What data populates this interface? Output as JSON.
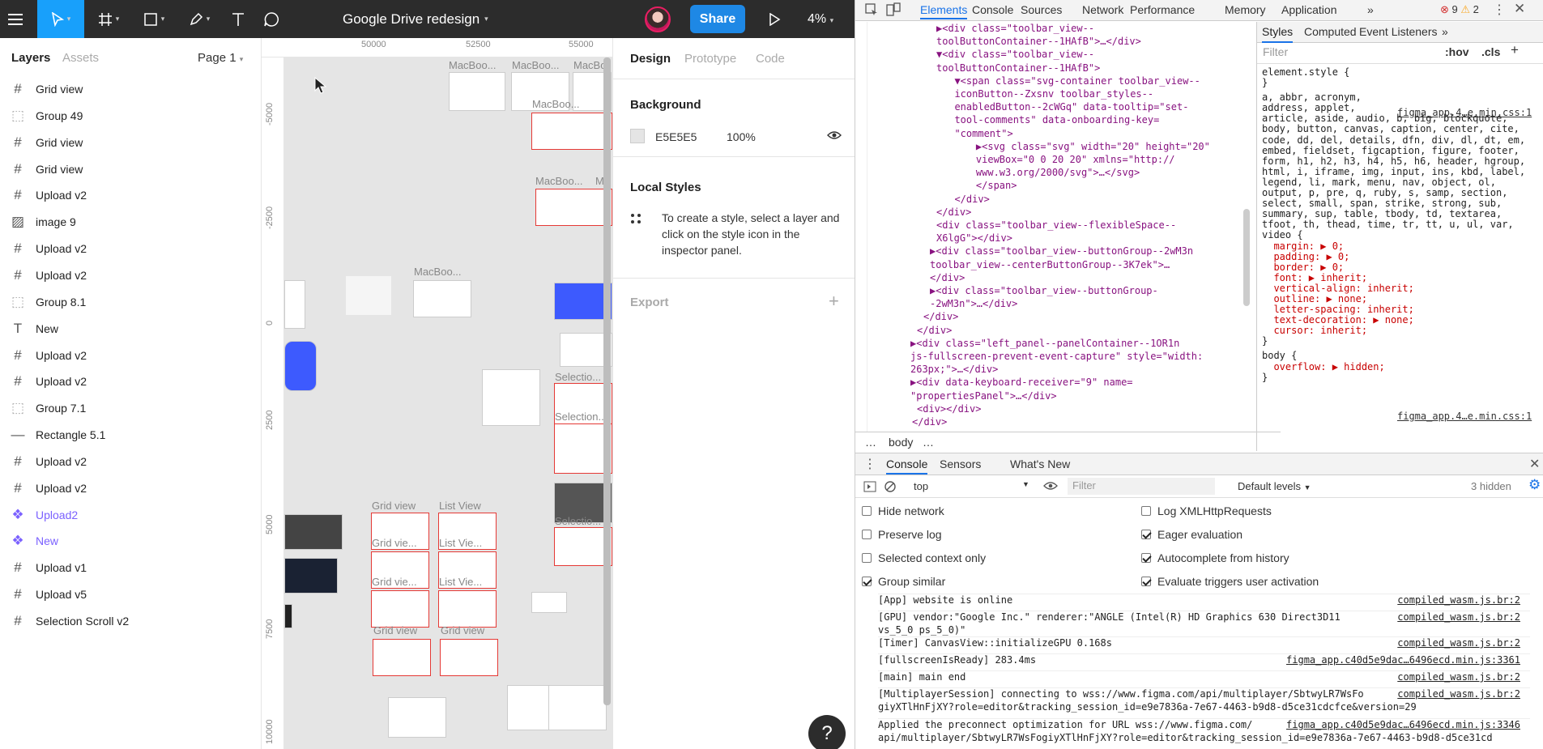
{
  "figma": {
    "file_title": "Google Drive redesign",
    "share_label": "Share",
    "zoom": "4%",
    "left_tabs": {
      "layers": "Layers",
      "assets": "Assets",
      "page": "Page 1"
    },
    "layers": [
      {
        "name": "Grid view",
        "icon": "frame-icon",
        "kind": "frame"
      },
      {
        "name": "Group 49",
        "icon": "group-icon",
        "kind": "group"
      },
      {
        "name": "Grid view",
        "icon": "frame-icon",
        "kind": "frame"
      },
      {
        "name": "Grid view",
        "icon": "frame-icon",
        "kind": "frame"
      },
      {
        "name": "Upload v2",
        "icon": "frame-icon",
        "kind": "frame"
      },
      {
        "name": "image 9",
        "icon": "image-icon",
        "kind": "image"
      },
      {
        "name": "Upload v2",
        "icon": "frame-icon",
        "kind": "frame"
      },
      {
        "name": "Upload v2",
        "icon": "frame-icon",
        "kind": "frame"
      },
      {
        "name": "Group 8.1",
        "icon": "group-icon",
        "kind": "group"
      },
      {
        "name": "New",
        "icon": "text-icon",
        "kind": "text"
      },
      {
        "name": "Upload v2",
        "icon": "frame-icon",
        "kind": "frame"
      },
      {
        "name": "Upload v2",
        "icon": "frame-icon",
        "kind": "frame"
      },
      {
        "name": "Group 7.1",
        "icon": "group-icon",
        "kind": "group"
      },
      {
        "name": "Rectangle 5.1",
        "icon": "line-icon",
        "kind": "line"
      },
      {
        "name": "Upload v2",
        "icon": "frame-icon",
        "kind": "frame"
      },
      {
        "name": "Upload v2",
        "icon": "frame-icon",
        "kind": "frame"
      },
      {
        "name": "Upload2",
        "icon": "component-icon",
        "kind": "component"
      },
      {
        "name": "New",
        "icon": "component-icon",
        "kind": "component"
      },
      {
        "name": "Upload v1",
        "icon": "frame-icon",
        "kind": "frame"
      },
      {
        "name": "Upload v5",
        "icon": "frame-icon",
        "kind": "frame"
      },
      {
        "name": "Selection Scroll v2",
        "icon": "frame-icon",
        "kind": "frame"
      }
    ],
    "ruler_top": [
      "50000",
      "52500",
      "55000"
    ],
    "ruler_left": [
      "-5000",
      "-2500",
      "0",
      "2500",
      "5000",
      "7500",
      "10000"
    ],
    "canvas_labels": [
      "MacBoo...",
      "MacBoo...",
      "MacBo",
      "MacBoo...",
      "MacBoo...",
      "Ma",
      "MacBoo...",
      "Grid view",
      "List View",
      "Grid vie...",
      "List Vie...",
      "Grid vie...",
      "List Vie...",
      "Grid view",
      "Grid view",
      "Selectio...",
      "Selection...",
      "Selectio..."
    ],
    "right_tabs": {
      "design": "Design",
      "prototype": "Prototype",
      "code": "Code"
    },
    "background": {
      "title": "Background",
      "hex": "E5E5E5",
      "opacity": "100%",
      "color": "#E5E5E5"
    },
    "local_styles": {
      "title": "Local Styles",
      "hint": "To create a style, select a layer and click on the style icon in the inspector panel."
    },
    "export": {
      "title": "Export",
      "add": "+"
    },
    "help": "?"
  },
  "devtools": {
    "tabs": [
      "Elements",
      "Console",
      "Sources",
      "Network",
      "Performance",
      "Memory",
      "Application",
      "»"
    ],
    "errors": "9",
    "warnings": "2",
    "elements_lines": [
      "▶<div class=\"toolbar_view--",
      "toolButtonContainer--1HAfB\">…</div>",
      "▼<div class=\"toolbar_view--",
      "toolButtonContainer--1HAfB\">",
      "  ▼<span class=\"svg-container toolbar_view--",
      "  iconButton--Zxsnv toolbar_styles--",
      "  enabledButton--2cWGq\" data-tooltip=\"set-",
      "  tool-comments\" data-onboarding-key=",
      "  \"comment\">",
      "    ▶<svg class=\"svg\" width=\"20\" height=\"20\"",
      "    viewBox=\"0 0 20 20\" xmlns=\"http://",
      "    www.w3.org/2000/svg\">…</svg>",
      "    </span>",
      "  </div>",
      "</div>",
      "<div class=\"toolbar_view--flexibleSpace--",
      "X6lgG\"></div>",
      "▶<div class=\"toolbar_view--buttonGroup--2wM3n",
      "toolbar_view--centerButtonGroup--3K7ek\">…",
      "</div>",
      "▶<div class=\"toolbar_view--buttonGroup-",
      "-2wM3n\">…</div>",
      "</div>",
      "</div>",
      "▶<div class=\"left_panel--panelContainer--1OR1n",
      "js-fullscreen-prevent-event-capture\" style=\"width:",
      "263px;\">…</div>",
      "▶<div data-keyboard-receiver=\"9\" name=",
      "\"propertiesPanel\">…</div>",
      "<div></div>",
      "</div>"
    ],
    "breadcrumb": [
      "…",
      "body",
      "…"
    ],
    "styles_tabs": [
      "Styles",
      "Computed",
      "Event Listeners",
      "»"
    ],
    "styles_filter": "Filter",
    "styles_hov": ":hov",
    "styles_cls": ".cls",
    "styles_lines": [
      "element.style {",
      "}",
      "a, abbr, acronym,",
      "address, applet,",
      "article, aside, audio, b, big, blockquote,",
      "body, button, canvas, caption, center, cite,",
      "code, dd, del, details, dfn, div, dl, dt, em,",
      "embed, fieldset, figcaption, figure, footer,",
      "form, h1, h2, h3, h4, h5, h6, header, hgroup,",
      "html, i, iframe, img, input, ins, kbd, label,",
      "legend, li, mark, menu, nav, object, ol,",
      "output, p, pre, q, ruby, s, samp, section,",
      "select, small, span, strike, strong, sub,",
      "summary, sup, table, tbody, td, textarea,",
      "tfoot, th, thead, time, tr, tt, u, ul, var,",
      "video {",
      "  margin: ▶ 0;",
      "  padding: ▶ 0;",
      "  border: ▶ 0;",
      "  font: ▶ inherit;",
      "  vertical-align: inherit;",
      "  outline: ▶ none;",
      "  letter-spacing: inherit;",
      "  text-decoration: ▶ none;",
      "  cursor: inherit;",
      "}",
      "body {",
      "  overflow: ▶ hidden;",
      "}"
    ],
    "styles_source": "figma_app.4…e.min.css:1",
    "drawer_tabs": [
      "Console",
      "Sensors",
      "What's New"
    ],
    "console_context": "top",
    "console_filter": "Filter",
    "console_levels": "Default levels",
    "console_hidden": "3 hidden",
    "settings": [
      {
        "label": "Hide network",
        "checked": false
      },
      {
        "label": "Log XMLHttpRequests",
        "checked": false
      },
      {
        "label": "Preserve log",
        "checked": false
      },
      {
        "label": "Eager evaluation",
        "checked": true
      },
      {
        "label": "Selected context only",
        "checked": false
      },
      {
        "label": "Autocomplete from history",
        "checked": true
      },
      {
        "label": "Group similar",
        "checked": true
      },
      {
        "label": "Evaluate triggers user activation",
        "checked": true
      }
    ],
    "logs": [
      {
        "text": "[App] website is online",
        "src": "compiled_wasm.js.br:2"
      },
      {
        "text": "[GPU] vendor:\"Google Inc.\" renderer:\"ANGLE (Intel(R) HD Graphics 630 Direct3D11\nvs_5_0 ps_5_0)\"",
        "src": "compiled_wasm.js.br:2"
      },
      {
        "text": "[Timer] CanvasView::initializeGPU 0.168s",
        "src": "compiled_wasm.js.br:2"
      },
      {
        "text": "[fullscreenIsReady] 283.4ms",
        "src": "figma_app.c40d5e9dac…6496ecd.min.js:3361"
      },
      {
        "text": "[main] main end",
        "src": "compiled_wasm.js.br:2"
      },
      {
        "text": "[MultiplayerSession] connecting to wss://www.figma.com/api/multiplayer/SbtwyLR7WsFo\ngiyXTlHnFjXY?role=editor&tracking_session_id=e9e7836a-7e67-4463-b9d8-d5ce31cdcfce&version=29",
        "src": "compiled_wasm.js.br:2"
      },
      {
        "text": "Applied the preconnect optimization for URL wss://www.figma.com/\napi/multiplayer/SbtwyLR7WsFogiyXTlHnFjXY?role=editor&tracking_session_id=e9e7836a-7e67-4463-b9d8-d5ce31cd",
        "src": "figma_app.c40d5e9dac…6496ecd.min.js:3346"
      }
    ]
  }
}
